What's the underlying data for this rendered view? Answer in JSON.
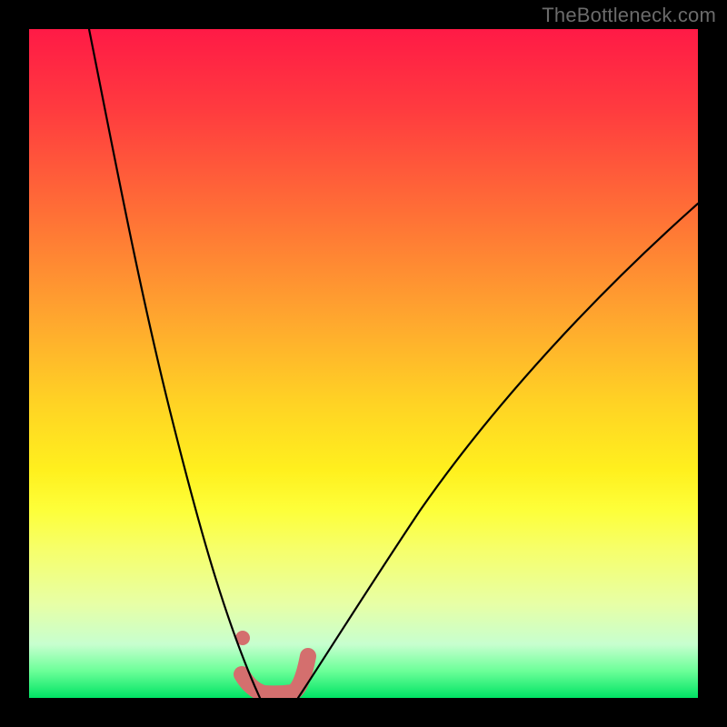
{
  "attribution": "TheBottleneck.com",
  "chart_data": {
    "type": "line",
    "title": "",
    "xlabel": "",
    "ylabel": "",
    "xlim": [
      0,
      100
    ],
    "ylim": [
      0,
      100
    ],
    "background_gradient": {
      "top": "#ff1a46",
      "middle": "#fff01e",
      "bottom": "#00e364"
    },
    "series": [
      {
        "name": "left-branch",
        "x": [
          9,
          12,
          15,
          18,
          21,
          24,
          27,
          29,
          31,
          33,
          34.5
        ],
        "y": [
          100,
          82,
          66,
          51,
          38,
          27,
          18,
          12,
          7,
          3,
          0
        ],
        "stroke": "#000000",
        "width": 2.2
      },
      {
        "name": "right-branch",
        "x": [
          40,
          44,
          50,
          58,
          68,
          80,
          92,
          100
        ],
        "y": [
          0,
          5,
          14,
          27,
          42,
          56,
          67,
          74
        ],
        "stroke": "#000000",
        "width": 2.2
      },
      {
        "name": "valley-highlight",
        "x": [
          32,
          33.5,
          35,
          37,
          39,
          41,
          41.5
        ],
        "y": [
          3.5,
          1.2,
          0.6,
          0.6,
          0.8,
          1.6,
          6
        ],
        "stroke": "#d46f6e",
        "width": 18
      }
    ],
    "annotations": [
      {
        "name": "start-dot",
        "x": 32,
        "y": 9,
        "r": 8,
        "fill": "#d46f6e"
      }
    ]
  }
}
